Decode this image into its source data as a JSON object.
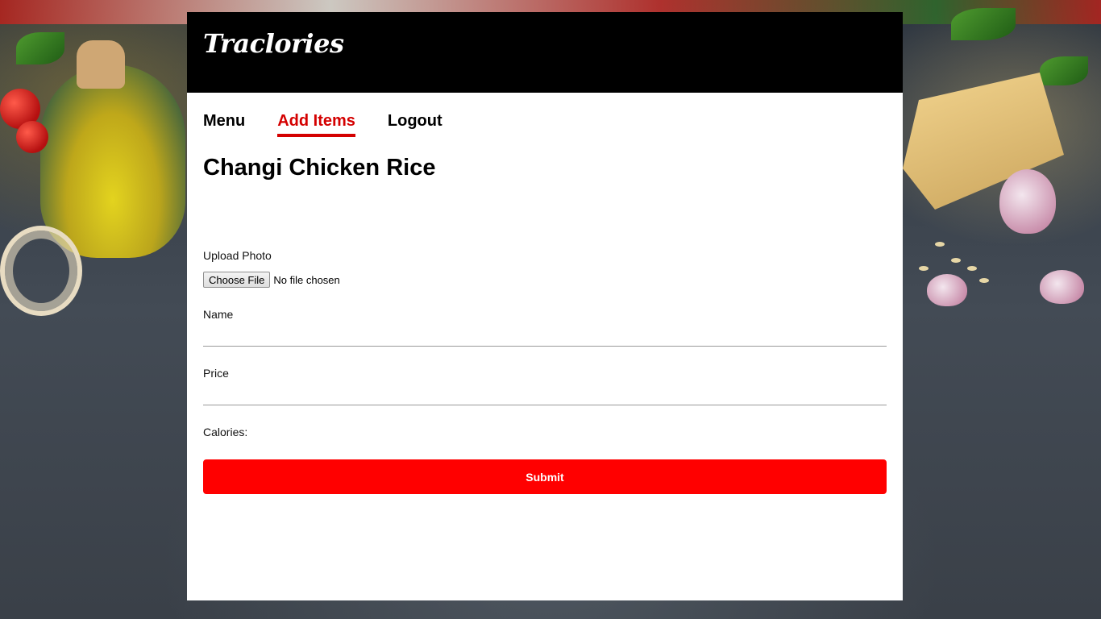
{
  "app": {
    "logo_text": "Traclories"
  },
  "nav": {
    "items": [
      {
        "label": "Menu",
        "active": false
      },
      {
        "label": "Add Items",
        "active": true
      },
      {
        "label": "Logout",
        "active": false
      }
    ],
    "active_color": "#d40000"
  },
  "page": {
    "title": "Changi Chicken Rice"
  },
  "form": {
    "upload_label": "Upload Photo",
    "file_button_label": "Choose File",
    "file_status": "No file chosen",
    "name_label": "Name",
    "name_value": "",
    "price_label": "Price",
    "price_value": "",
    "calories_label": "Calories:",
    "submit_label": "Submit"
  },
  "colors": {
    "header_bg": "#000000",
    "submit_bg": "#ff0000",
    "panel_bg": "#ffffff"
  }
}
